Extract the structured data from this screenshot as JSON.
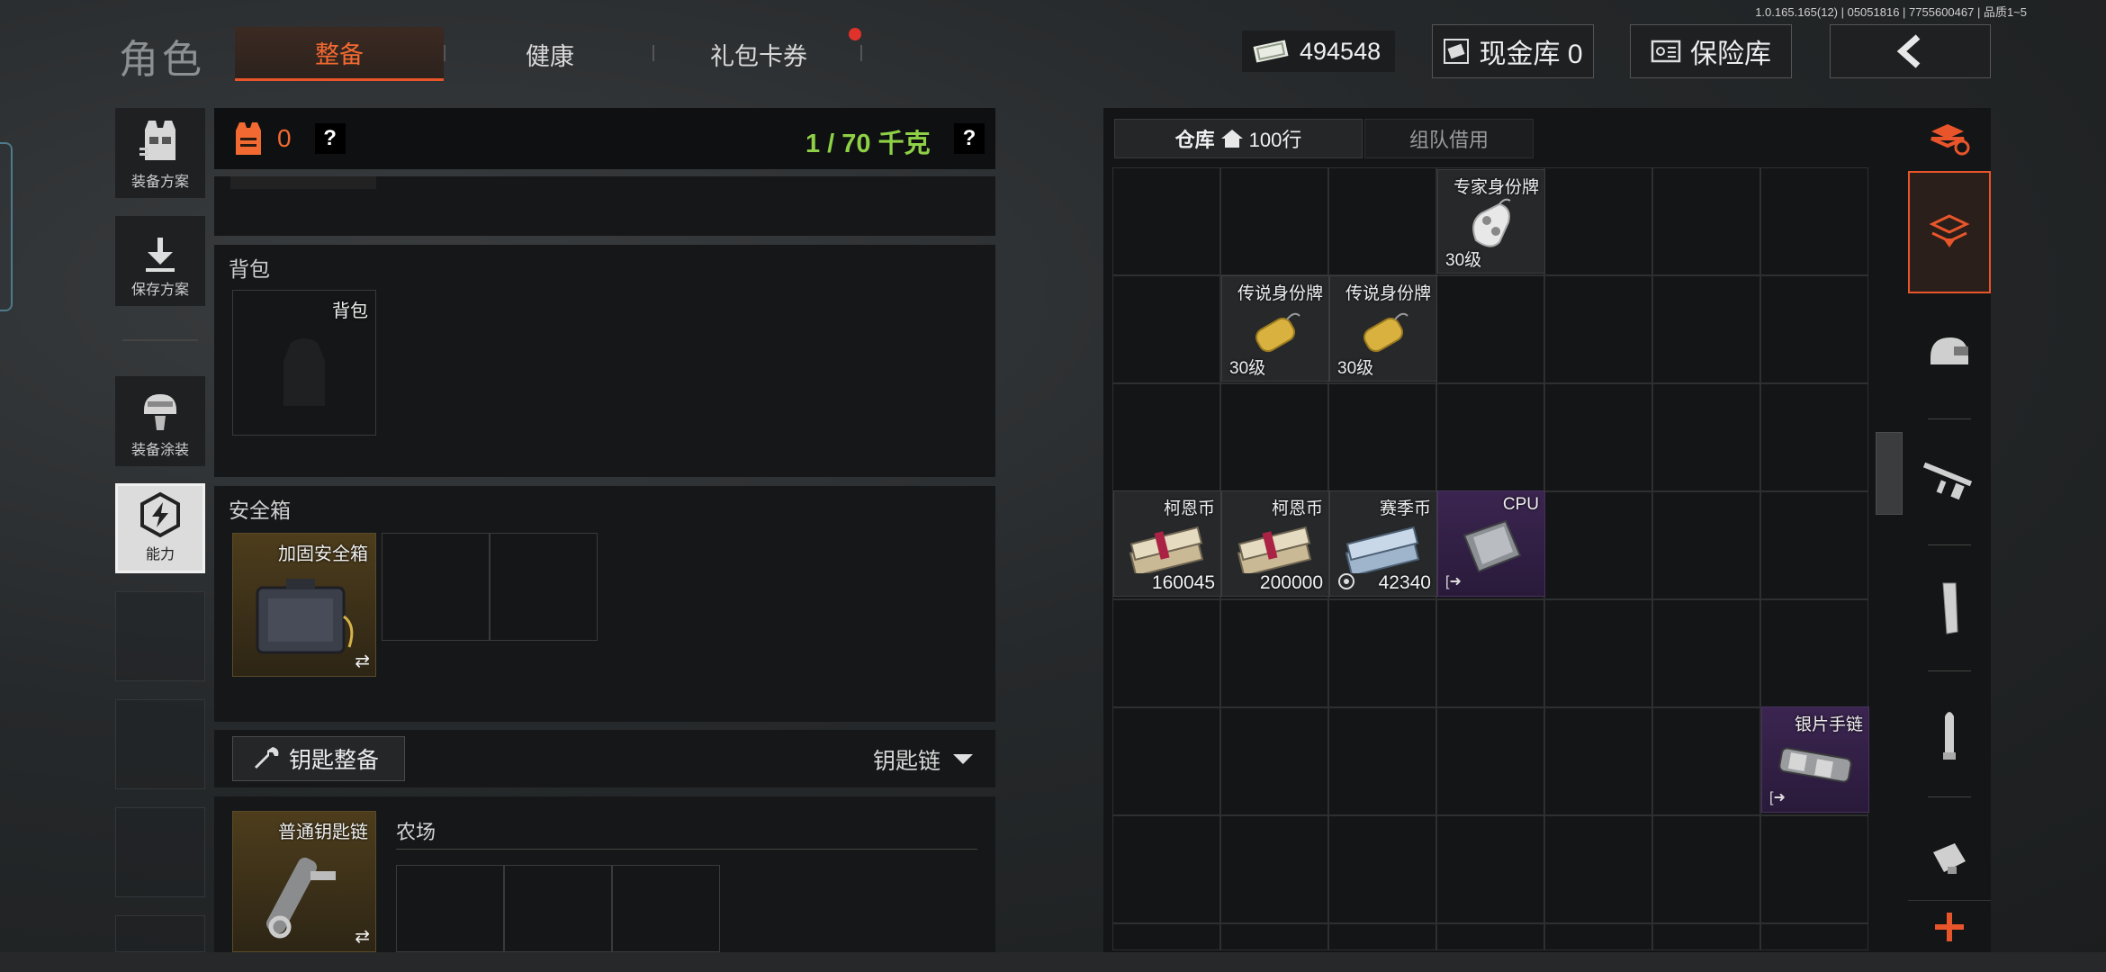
{
  "version": "1.0.165.165(12) | 05051816 | 7755600467 | 品质1~5",
  "header": {
    "title": "角色",
    "tabs": [
      {
        "label": "整备",
        "active": true
      },
      {
        "label": "健康",
        "active": false
      },
      {
        "label": "礼包卡券",
        "active": false,
        "notification": true
      }
    ],
    "currency": "494548",
    "cash_vault": "现金库 0",
    "insurance": "保险库"
  },
  "sidebar": {
    "items": [
      {
        "label": "装备方案",
        "icon": "vest-plan-icon"
      },
      {
        "label": "保存方案",
        "icon": "download-icon"
      },
      {
        "label": "装备涂装",
        "icon": "helmet-paint-icon"
      },
      {
        "label": "能力",
        "icon": "ability-icon",
        "selected": true
      }
    ]
  },
  "loadout": {
    "vest_count": "0",
    "help": "?",
    "weight": "1 / 70 千克",
    "backpack": {
      "title": "背包",
      "slot_label": "背包"
    },
    "safebox": {
      "title": "安全箱",
      "item_label": "加固安全箱"
    },
    "keys": {
      "button": "钥匙整备",
      "selector": "钥匙链",
      "item_label": "普通钥匙链",
      "location": "农场"
    }
  },
  "warehouse": {
    "tab_label": "仓库",
    "rows": "100行",
    "team_tab": "组队借用",
    "items": [
      {
        "name": "专家身份牌",
        "level": "30级",
        "icon": "dogtag-silver-icon"
      },
      {
        "name": "传说身份牌",
        "level": "30级",
        "icon": "dogtag-gold-icon"
      },
      {
        "name": "传说身份牌",
        "level": "30级",
        "icon": "dogtag-gold-icon"
      },
      {
        "name": "柯恩币",
        "count": "160045",
        "icon": "cash-stack-icon"
      },
      {
        "name": "柯恩币",
        "count": "200000",
        "icon": "cash-stack-icon"
      },
      {
        "name": "赛季币",
        "count": "42340",
        "icon": "season-cash-icon"
      },
      {
        "name": "CPU",
        "icon": "cpu-chip-icon",
        "rarity": "purple"
      },
      {
        "name": "银片手链",
        "icon": "silver-bracelet-icon",
        "rarity": "purple"
      }
    ]
  },
  "categories": [
    "all-items-icon",
    "warehouse-sort-icon",
    "helmet-icon",
    "rifle-icon",
    "magazine-icon",
    "ammo-icon",
    "scope-icon",
    "add-icon"
  ],
  "colors": {
    "accent": "#e8552a",
    "weight_green": "#8ed146",
    "rarity_purple": "#3b2550",
    "rarity_gold": "#4d3d1c"
  }
}
